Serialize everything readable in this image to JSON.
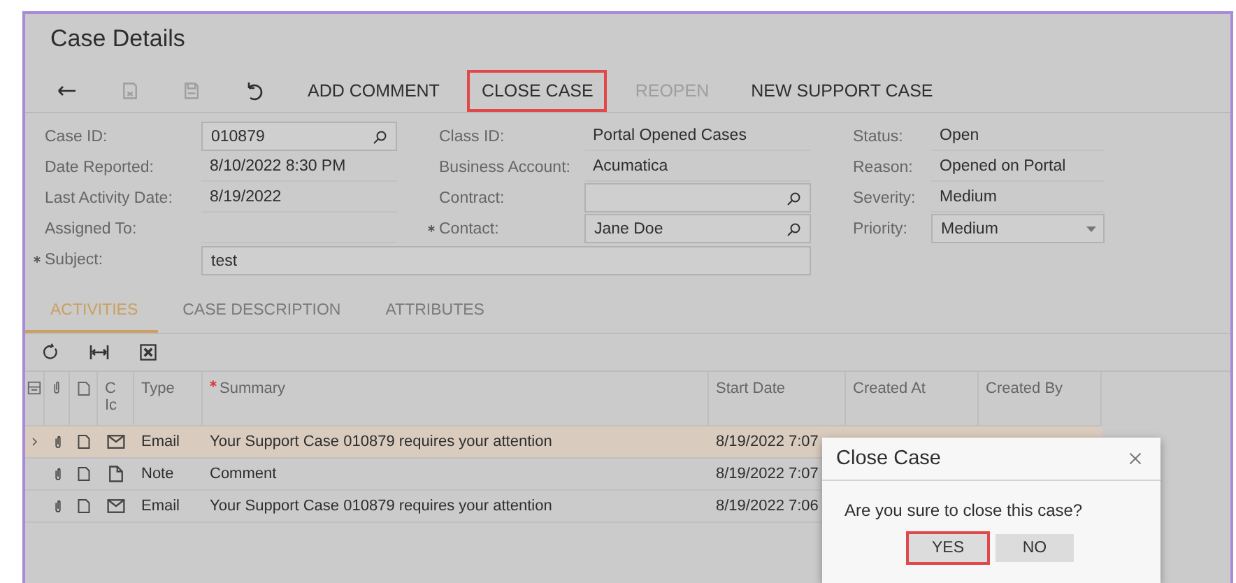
{
  "window": {
    "title": "Case Details"
  },
  "toolbar": [
    {
      "kind": "back",
      "disabled": false,
      "annotated": false
    },
    {
      "kind": "save-close",
      "disabled": true,
      "annotated": false
    },
    {
      "kind": "save",
      "disabled": true,
      "annotated": false
    },
    {
      "kind": "undo",
      "disabled": false,
      "annotated": false
    },
    {
      "kind": "text",
      "label": "ADD COMMENT",
      "disabled": false,
      "annotated": false
    },
    {
      "kind": "text",
      "label": "CLOSE CASE",
      "disabled": false,
      "annotated": true
    },
    {
      "kind": "text",
      "label": "REOPEN",
      "disabled": true,
      "annotated": false
    },
    {
      "kind": "text",
      "label": "NEW SUPPORT CASE",
      "disabled": false,
      "annotated": false
    }
  ],
  "form": {
    "left": [
      {
        "label": "Case ID:",
        "value": "010879",
        "kind": "lookup",
        "required": false
      },
      {
        "label": "Date Reported:",
        "value": "8/10/2022 8:30 PM",
        "kind": "text",
        "required": false
      },
      {
        "label": "Last Activity Date:",
        "value": "8/19/2022",
        "kind": "text",
        "required": false
      },
      {
        "label": "Assigned To:",
        "kind": "text",
        "required": false
      }
    ],
    "middle": [
      {
        "label": "Class ID:",
        "value": "Portal Opened Cases",
        "kind": "text",
        "required": false
      },
      {
        "label": "Business Account:",
        "value": "Acumatica",
        "kind": "text",
        "required": false
      },
      {
        "label": "Contract:",
        "kind": "lookup",
        "required": false
      },
      {
        "label": "Contact:",
        "value": "Jane Doe",
        "kind": "lookup",
        "required": true
      }
    ],
    "right": [
      {
        "label": "Status:",
        "value": "Open",
        "kind": "text",
        "required": false
      },
      {
        "label": "Reason:",
        "value": "Opened on Portal",
        "kind": "text",
        "required": false
      },
      {
        "label": "Severity:",
        "value": "Medium",
        "kind": "text",
        "required": false
      },
      {
        "label": "Priority:",
        "value": "Medium",
        "kind": "select",
        "required": false
      }
    ],
    "subject": {
      "label": "Subject:",
      "value": "test",
      "kind": "input",
      "required": true
    }
  },
  "tabs": [
    {
      "label": "ACTIVITIES",
      "selected": true
    },
    {
      "label": "CASE DESCRIPTION",
      "selected": false
    },
    {
      "label": "ATTRIBUTES",
      "selected": false
    }
  ],
  "grid_toolbar": [
    {
      "kind": "refresh"
    },
    {
      "kind": "fit"
    },
    {
      "kind": "excel"
    }
  ],
  "table": {
    "columns": [
      {
        "kind": "files"
      },
      {
        "kind": "attach"
      },
      {
        "kind": "doc"
      },
      {
        "kind": "text",
        "label": "C Ic"
      },
      {
        "kind": "text",
        "label": "Type"
      },
      {
        "kind": "text",
        "label": "Summary",
        "required": true
      },
      {
        "kind": "text",
        "label": "Start Date"
      },
      {
        "kind": "text",
        "label": "Created At"
      },
      {
        "kind": "text",
        "label": "Created By"
      }
    ],
    "rows": [
      {
        "selected": true,
        "kind": "email",
        "type": "Email",
        "summary": "Your Support Case 010879 requires your attention",
        "start_date": "8/19/2022 7:07"
      },
      {
        "selected": false,
        "kind": "note",
        "type": "Note",
        "summary": "Comment",
        "start_date": "8/19/2022 7:07"
      },
      {
        "selected": false,
        "kind": "email",
        "type": "Email",
        "summary": "Your Support Case 010879 requires your attention",
        "start_date": "8/19/2022 7:06"
      }
    ]
  },
  "dialog": {
    "title": "Close Case",
    "message": "Are you sure to close this case?",
    "buttons": [
      {
        "label": "YES",
        "annotated": true
      },
      {
        "label": "NO",
        "annotated": false
      }
    ]
  }
}
